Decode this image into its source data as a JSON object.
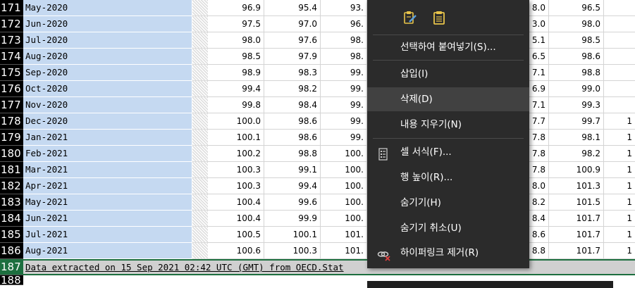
{
  "rows": [
    {
      "num": "171",
      "label": "May-2020",
      "v1": "96.9",
      "v2": "95.4",
      "v3": "93.",
      "v5": "8.0",
      "v6": "96.5",
      "v7": ""
    },
    {
      "num": "172",
      "label": "Jun-2020",
      "v1": "97.5",
      "v2": "97.0",
      "v3": "96.",
      "v5": "3.0",
      "v6": "98.0",
      "v7": ""
    },
    {
      "num": "173",
      "label": "Jul-2020",
      "v1": "98.0",
      "v2": "97.6",
      "v3": "98.",
      "v5": "5.1",
      "v6": "98.5",
      "v7": ""
    },
    {
      "num": "174",
      "label": "Aug-2020",
      "v1": "98.5",
      "v2": "97.9",
      "v3": "98.",
      "v5": "6.5",
      "v6": "98.6",
      "v7": ""
    },
    {
      "num": "175",
      "label": "Sep-2020",
      "v1": "98.9",
      "v2": "98.3",
      "v3": "99.",
      "v5": "7.1",
      "v6": "98.8",
      "v7": ""
    },
    {
      "num": "176",
      "label": "Oct-2020",
      "v1": "99.4",
      "v2": "98.2",
      "v3": "99.",
      "v5": "6.9",
      "v6": "99.0",
      "v7": ""
    },
    {
      "num": "177",
      "label": "Nov-2020",
      "v1": "99.8",
      "v2": "98.4",
      "v3": "99.",
      "v5": "7.1",
      "v6": "99.3",
      "v7": ""
    },
    {
      "num": "178",
      "label": "Dec-2020",
      "v1": "100.0",
      "v2": "98.6",
      "v3": "99.",
      "v5": "7.7",
      "v6": "99.7",
      "v7": "1"
    },
    {
      "num": "179",
      "label": "Jan-2021",
      "v1": "100.1",
      "v2": "98.6",
      "v3": "99.",
      "v5": "7.8",
      "v6": "98.1",
      "v7": "1"
    },
    {
      "num": "180",
      "label": "Feb-2021",
      "v1": "100.2",
      "v2": "98.8",
      "v3": "100.",
      "v5": "7.8",
      "v6": "98.2",
      "v7": "1"
    },
    {
      "num": "181",
      "label": "Mar-2021",
      "v1": "100.3",
      "v2": "99.1",
      "v3": "100.",
      "v5": "7.8",
      "v6": "100.9",
      "v7": "1"
    },
    {
      "num": "182",
      "label": "Apr-2021",
      "v1": "100.3",
      "v2": "99.4",
      "v3": "100.",
      "v5": "8.0",
      "v6": "101.3",
      "v7": "1"
    },
    {
      "num": "183",
      "label": "May-2021",
      "v1": "100.4",
      "v2": "99.6",
      "v3": "100.",
      "v5": "8.2",
      "v6": "101.5",
      "v7": "1"
    },
    {
      "num": "184",
      "label": "Jun-2021",
      "v1": "100.4",
      "v2": "99.9",
      "v3": "100.",
      "v5": "8.4",
      "v6": "101.7",
      "v7": "1"
    },
    {
      "num": "185",
      "label": "Jul-2021",
      "v1": "100.5",
      "v2": "100.1",
      "v3": "101.",
      "v5": "8.6",
      "v6": "101.7",
      "v7": "1"
    },
    {
      "num": "186",
      "label": "Aug-2021",
      "v1": "100.6",
      "v2": "100.3",
      "v3": "101.",
      "v5": "8.8",
      "v6": "101.7",
      "v7": "1"
    }
  ],
  "footer": {
    "num": "187",
    "text": "Data extracted on 15 Sep 2021 02:42 UTC (GMT) from OECD.Stat",
    "next_num": "188"
  },
  "context_menu": {
    "paste_icons": [
      "paste-edit-icon",
      "clipboard-icon"
    ],
    "items": [
      {
        "label": "선택하여 붙여넣기(S)...",
        "icon": ""
      },
      {
        "label": "삽입(I)",
        "icon": ""
      },
      {
        "label": "삭제(D)",
        "icon": "",
        "highlighted": true
      },
      {
        "label": "내용 지우기(N)",
        "icon": ""
      },
      {
        "label": "셀 서식(F)...",
        "icon": "format-cells-icon"
      },
      {
        "label": "행 높이(R)...",
        "icon": ""
      },
      {
        "label": "숨기기(H)",
        "icon": ""
      },
      {
        "label": "숨기기 취소(U)",
        "icon": ""
      },
      {
        "label": "하이퍼링크 제거(R)",
        "icon": "remove-link-icon"
      }
    ]
  },
  "colors": {
    "selection": "#c5d9f1",
    "menu_bg": "#2b2b2b",
    "accent": "#1d6f3f"
  }
}
